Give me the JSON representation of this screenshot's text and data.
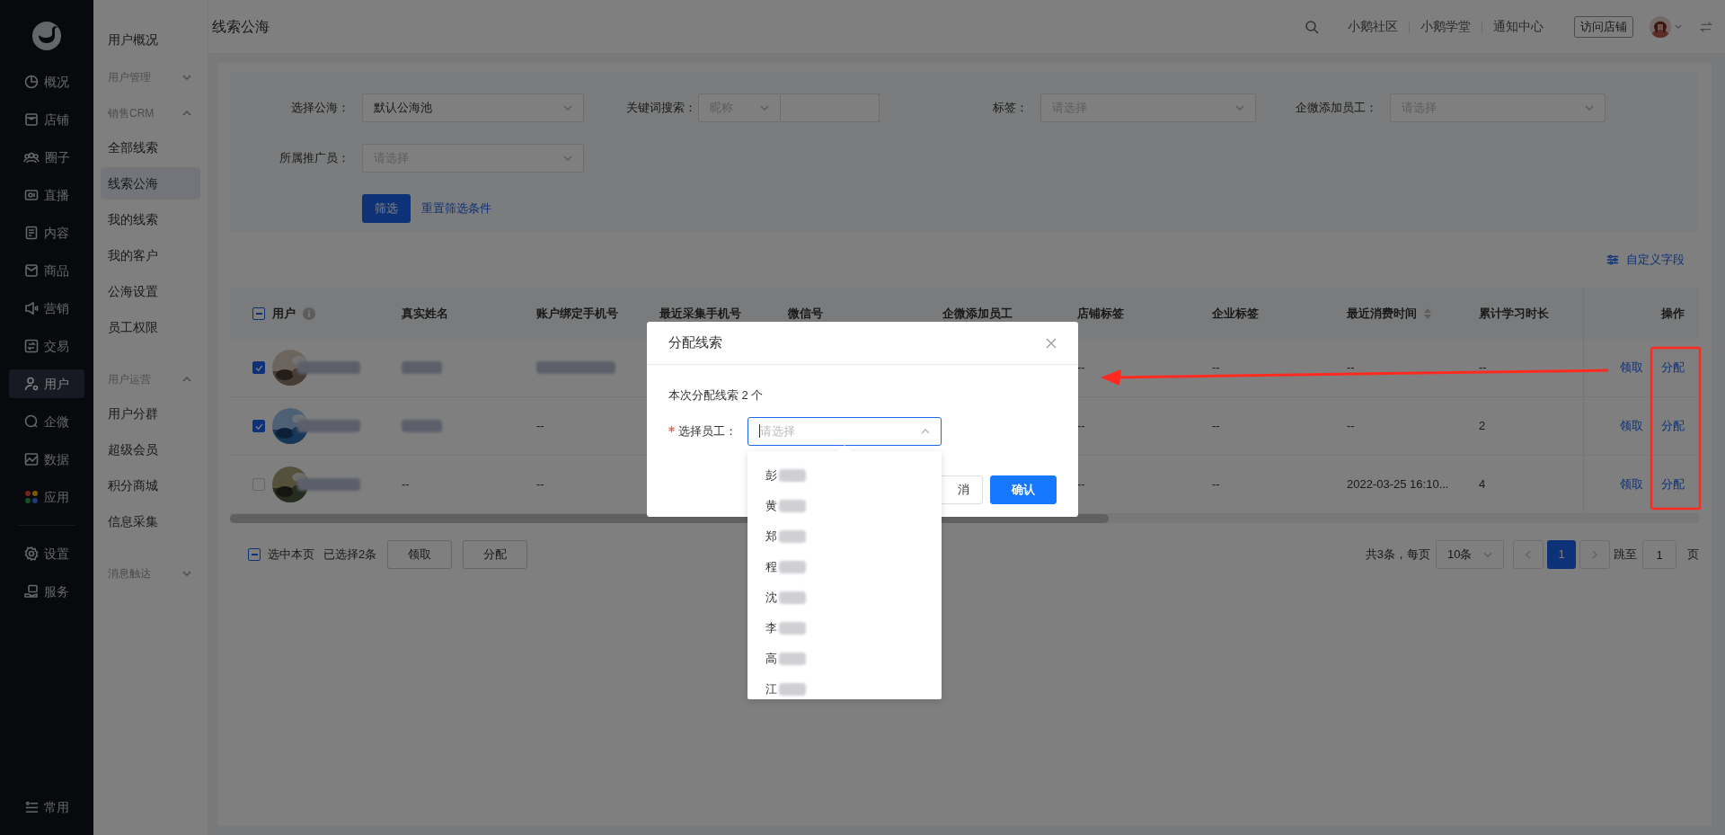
{
  "sidebar": {
    "items": [
      {
        "label": "概况",
        "selected": false
      },
      {
        "label": "店铺",
        "selected": false
      },
      {
        "label": "圈子",
        "selected": false
      },
      {
        "label": "直播",
        "selected": false
      },
      {
        "label": "内容",
        "selected": false
      },
      {
        "label": "商品",
        "selected": false
      },
      {
        "label": "营销",
        "selected": false
      },
      {
        "label": "交易",
        "selected": false
      },
      {
        "label": "用户",
        "selected": true
      },
      {
        "label": "企微",
        "selected": false
      },
      {
        "label": "数据",
        "selected": false
      },
      {
        "label": "应用",
        "selected": false
      }
    ],
    "settings_items": [
      {
        "label": "设置",
        "selected": false
      },
      {
        "label": "服务",
        "selected": false
      }
    ],
    "bottom_item": "常用"
  },
  "subnav": {
    "sections": [
      {
        "items": [
          {
            "label": "用户概况",
            "selected": false
          }
        ]
      },
      {
        "title": "用户管理",
        "expanded": false
      },
      {
        "title": "销售CRM",
        "expanded": true,
        "items": [
          {
            "label": "全部线索",
            "selected": false
          },
          {
            "label": "线索公海",
            "selected": true
          },
          {
            "label": "我的线索",
            "selected": false
          },
          {
            "label": "我的客户",
            "selected": false
          },
          {
            "label": "公海设置",
            "selected": false
          },
          {
            "label": "员工权限",
            "selected": false
          }
        ]
      },
      {
        "title": "用户运营",
        "expanded": true,
        "items": [
          {
            "label": "用户分群",
            "selected": false
          },
          {
            "label": "超级会员",
            "selected": false
          },
          {
            "label": "积分商城",
            "selected": false
          },
          {
            "label": "信息采集",
            "selected": false
          }
        ]
      },
      {
        "title": "消息触达",
        "expanded": false
      }
    ]
  },
  "header": {
    "title": "线索公海",
    "links": [
      "小鹅社区",
      "小鹅学堂",
      "通知中心"
    ],
    "visit_button": "访问店铺"
  },
  "filters": [
    {
      "kind": "select",
      "label": "选择公海：",
      "value": "默认公海池"
    },
    {
      "kind": "keyword",
      "label": "关键词搜索：",
      "type_value": "昵称"
    },
    {
      "kind": "select",
      "label": "标签：",
      "placeholder": "请选择"
    },
    {
      "kind": "select",
      "label": "企微添加员工：",
      "placeholder": "请选择"
    },
    {
      "kind": "select",
      "label": "所属推广员：",
      "placeholder": "请选择"
    }
  ],
  "filter_buttons": {
    "submit": "筛选",
    "reset": "重置筛选条件"
  },
  "custom_fields_link": "自定义字段",
  "table": {
    "header_checkbox": {
      "indeterminate": true
    },
    "columns": [
      {
        "label": "用户",
        "info": true
      },
      {
        "label": "真实姓名"
      },
      {
        "label": "账户绑定手机号"
      },
      {
        "label": "最近采集手机号"
      },
      {
        "label": "微信号"
      },
      {
        "label": "企微添加员工"
      },
      {
        "label": "店铺标签"
      },
      {
        "label": "企业标签"
      },
      {
        "label": "最近消费时间",
        "sortable": true
      },
      {
        "label": "累计学习时长"
      },
      {
        "label": "操作"
      }
    ],
    "rows": [
      {
        "checked": true,
        "cells": [
          {
            "kind": "user"
          },
          {
            "kind": "redacted"
          },
          {
            "kind": "redacted"
          },
          {
            "kind": "hidden"
          },
          {
            "kind": "hidden"
          },
          {
            "kind": "hidden"
          },
          {
            "kind": "text",
            "text": "--"
          },
          {
            "kind": "text",
            "text": "--"
          },
          {
            "kind": "text",
            "text": "--"
          },
          {
            "kind": "text",
            "text": "--"
          }
        ],
        "actions": [
          "领取",
          "分配"
        ]
      },
      {
        "checked": true,
        "cells": [
          {
            "kind": "user"
          },
          {
            "kind": "redacted"
          },
          {
            "kind": "text",
            "text": "--"
          },
          {
            "kind": "hidden"
          },
          {
            "kind": "hidden"
          },
          {
            "kind": "hidden"
          },
          {
            "kind": "text",
            "text": "--"
          },
          {
            "kind": "text",
            "text": "--"
          },
          {
            "kind": "text",
            "text": "--"
          },
          {
            "kind": "text",
            "text": "2"
          }
        ],
        "actions": [
          "领取",
          "分配"
        ]
      },
      {
        "checked": false,
        "cells": [
          {
            "kind": "user"
          },
          {
            "kind": "text",
            "text": "--"
          },
          {
            "kind": "text",
            "text": "--"
          },
          {
            "kind": "hidden"
          },
          {
            "kind": "hidden"
          },
          {
            "kind": "hidden"
          },
          {
            "kind": "text",
            "text": "--"
          },
          {
            "kind": "text",
            "text": "--"
          },
          {
            "kind": "text",
            "text": "2022-03-25 16:10..."
          },
          {
            "kind": "text",
            "text": "4"
          }
        ],
        "actions": [
          "领取",
          "分配"
        ]
      }
    ]
  },
  "bulk_bar": {
    "select_page": "选中本页",
    "indeterminate": true,
    "selected_count": "已选择2条",
    "buttons": [
      "领取",
      "分配"
    ]
  },
  "pagination": {
    "total": "共3条，每页",
    "page_size": "10条",
    "pages": [
      {
        "label": "1",
        "selected": true
      }
    ],
    "jump_label": "跳至",
    "jump_value": "1",
    "page_suffix": "页"
  },
  "modal": {
    "title": "分配线索",
    "message": "本次分配线索 2 个",
    "field": {
      "label": "选择员工：",
      "required": true,
      "placeholder": "请选择",
      "open": true
    },
    "buttons": [
      {
        "kind": "default",
        "label": "消"
      },
      {
        "kind": "primary",
        "label": "确认"
      }
    ]
  },
  "dropdown": {
    "options": [
      {
        "label": "彭"
      },
      {
        "label": "黄"
      },
      {
        "label": "郑"
      },
      {
        "label": "程"
      },
      {
        "label": "沈"
      },
      {
        "label": "李"
      },
      {
        "label": "高"
      },
      {
        "label": "江"
      }
    ]
  }
}
